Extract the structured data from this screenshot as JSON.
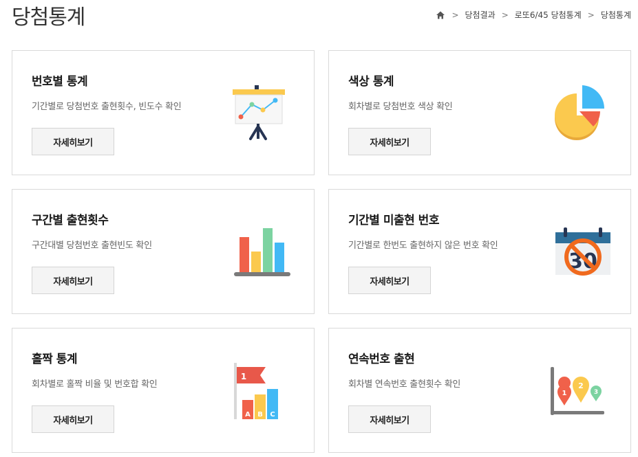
{
  "page": {
    "title": "당첨통계"
  },
  "breadcrumb": {
    "home_icon": "home-icon",
    "items": [
      "당첨결과",
      "로또6/45 당첨통계",
      "당첨통계"
    ]
  },
  "cards": [
    {
      "title": "번호별 통계",
      "desc": "기간별로 당첨번호 출현횟수, 빈도수 확인",
      "button": "자세히보기",
      "icon": "presentation-board-icon"
    },
    {
      "title": "색상 통계",
      "desc": "회차별로 당첨번호 색상 확인",
      "button": "자세히보기",
      "icon": "pie-chart-icon"
    },
    {
      "title": "구간별 출현횟수",
      "desc": "구간대별 당첨번호 출현빈도 확인",
      "button": "자세히보기",
      "icon": "bar-chart-icon"
    },
    {
      "title": "기간별 미출현 번호",
      "desc": "기간별로 한번도 출현하지 않은 번호 확인",
      "button": "자세히보기",
      "icon": "calendar-prohibited-icon",
      "calendar_number": "30"
    },
    {
      "title": "홀짝 통계",
      "desc": "회차별로 홀짝 비율 및 번호합 확인",
      "button": "자세히보기",
      "icon": "flag-bar-chart-icon",
      "flag_number": "1",
      "bar_letters": [
        "A",
        "B",
        "C"
      ]
    },
    {
      "title": "연속번호 출현",
      "desc": "회차별 연속번호 출현횟수 확인",
      "button": "자세히보기",
      "icon": "map-pins-chart-icon",
      "pin_numbers": [
        "1",
        "2",
        "3"
      ]
    }
  ],
  "colors": {
    "red": "#f0614a",
    "yellow": "#fbc94e",
    "green": "#7cd3a1",
    "blue": "#42b9f5",
    "navy": "#273553",
    "orange": "#f06a1e"
  }
}
